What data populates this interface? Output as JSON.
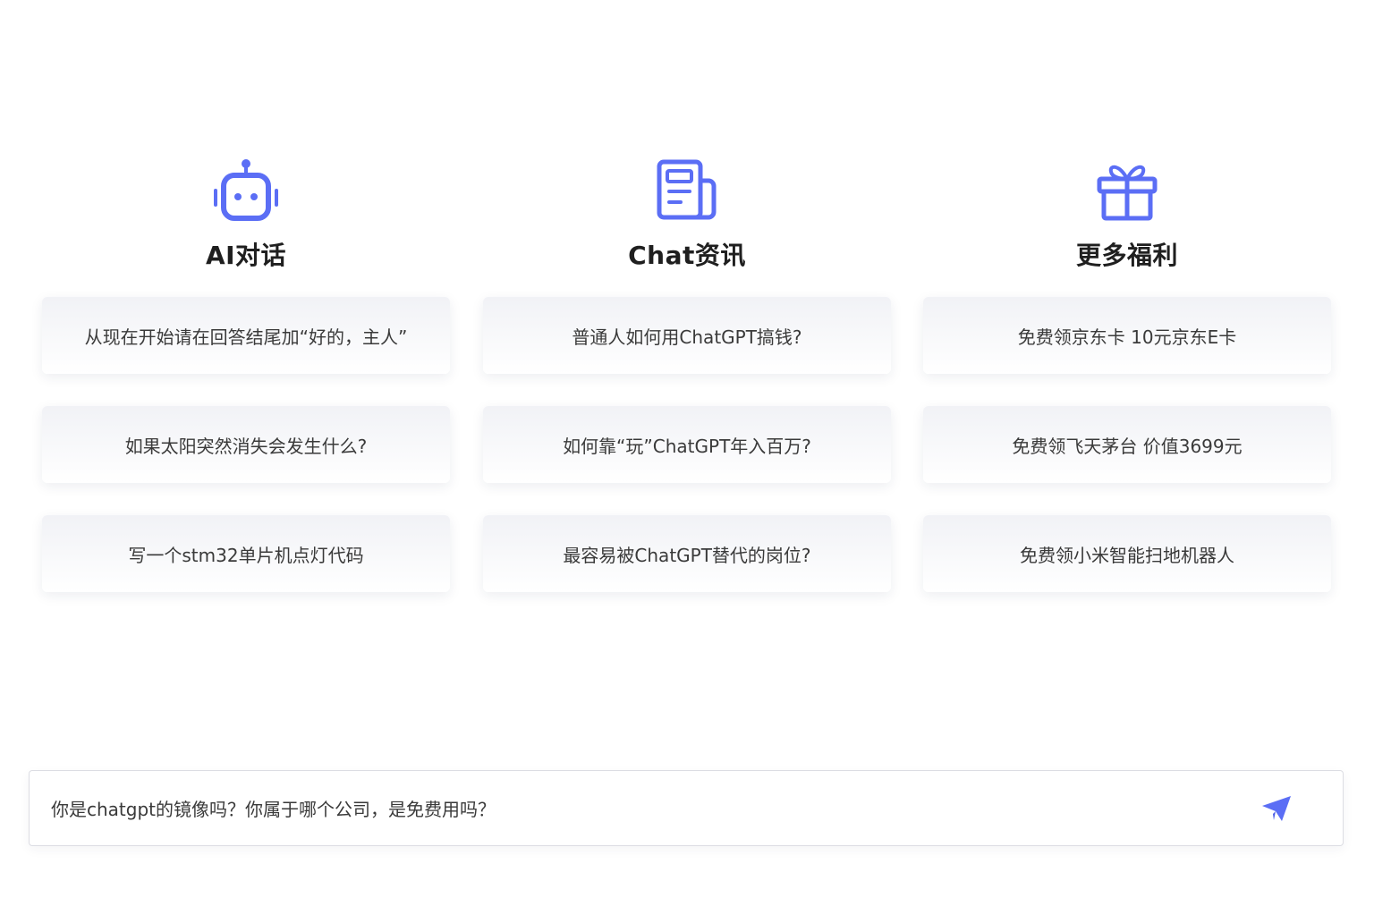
{
  "theme": {
    "accent": "#5b6ef5",
    "text": "#3a3a3a",
    "heading": "#1f1f1f"
  },
  "columns": [
    {
      "title": "AI对话",
      "icon": "robot-icon",
      "items": [
        "从现在开始请在回答结尾加“好的，主人”",
        "如果太阳突然消失会发生什么?",
        "写一个stm32单片机点灯代码"
      ]
    },
    {
      "title": "Chat资讯",
      "icon": "newspaper-icon",
      "items": [
        "普通人如何用ChatGPT搞钱?",
        "如何靠“玩”ChatGPT年入百万?",
        "最容易被ChatGPT替代的岗位?"
      ]
    },
    {
      "title": "更多福利",
      "icon": "gift-icon",
      "items": [
        "免费领京东卡 10元京东E卡",
        "免费领飞天茅台 价值3699元",
        "免费领小米智能扫地机器人"
      ]
    }
  ],
  "input": {
    "value": "你是chatgpt的镜像吗？你属于哪个公司，是免费用吗？",
    "send_icon": "paper-plane-icon"
  }
}
